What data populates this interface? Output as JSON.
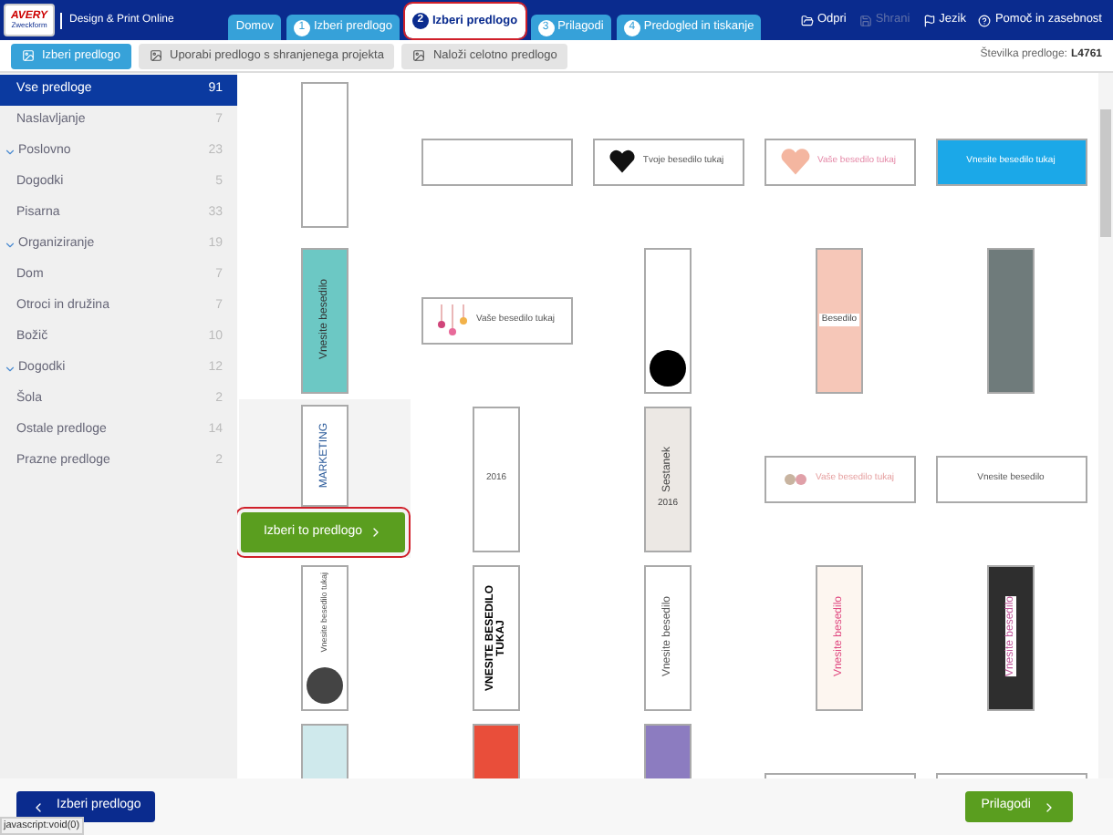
{
  "header": {
    "logo": [
      "AVERY",
      "Zweckform"
    ],
    "app_title": "Design & Print Online",
    "steps": [
      {
        "label": "Domov",
        "selected": false
      },
      {
        "number": "1",
        "label": "Izberi predlogo",
        "selected": false
      },
      {
        "number": "2",
        "label": "Izberi predlogo",
        "selected": true
      },
      {
        "number": "3",
        "label": "Prilagodi",
        "selected": false
      },
      {
        "number": "4",
        "label": "Predogled in tiskanje",
        "selected": false
      }
    ],
    "actions": [
      {
        "kind": "open",
        "label": "Odpri",
        "disabled": false
      },
      {
        "kind": "save",
        "label": "Shrani",
        "disabled": true
      },
      {
        "kind": "language",
        "label": "Jezik",
        "disabled": false
      },
      {
        "kind": "help",
        "label": "Pomoč in zasebnost",
        "disabled": false
      }
    ]
  },
  "toolbar": {
    "buttons": [
      {
        "label": "Izberi predlogo",
        "selected": true
      },
      {
        "label": "Uporabi predlogo s shranjenega projekta",
        "selected": false
      },
      {
        "label": "Naloži celotno predlogo",
        "selected": false
      }
    ],
    "template_number_label": "Številka predloge:",
    "template_number": "L4761"
  },
  "sidebar": {
    "items": [
      {
        "label": "Vse predloge",
        "count": "91",
        "selected": true
      },
      {
        "label": "Naslavljanje",
        "count": "7",
        "selected": false
      },
      {
        "label": "Poslovno",
        "count": "23",
        "selected": false,
        "expanded": true,
        "children": [
          {
            "label": "Dogodki",
            "count": "5",
            "selected": false
          },
          {
            "label": "Pisarna",
            "count": "33",
            "selected": false
          }
        ]
      },
      {
        "label": "Organiziranje",
        "count": "19",
        "selected": false,
        "expanded": true,
        "children": [
          {
            "label": "Dom",
            "count": "7",
            "selected": false
          },
          {
            "label": "Otroci in družina",
            "count": "7",
            "selected": false
          },
          {
            "label": "Božič",
            "count": "10",
            "selected": false
          }
        ]
      },
      {
        "label": "Dogodki",
        "count": "12",
        "selected": false,
        "expanded": true,
        "children": [
          {
            "label": "Šola",
            "count": "2",
            "selected": false
          },
          {
            "label": "Ostale predloge",
            "count": "14",
            "selected": false
          },
          {
            "label": "Prazne predloge",
            "count": "2",
            "selected": false
          }
        ]
      }
    ]
  },
  "templates": [
    {
      "kind": "tall"
    },
    {
      "kind": "wide"
    },
    {
      "kind": "wide",
      "texts": [
        "Tvoje besedilo tukaj"
      ]
    },
    {
      "kind": "wide",
      "texts": [
        "Vaše besedilo tukaj"
      ]
    },
    {
      "kind": "wide",
      "texts": [
        "Vnesite besedilo tukaj"
      ]
    },
    {
      "kind": "tall",
      "texts": [
        "Vnesite besedilo"
      ]
    },
    {
      "kind": "wide",
      "texts": [
        "Vaše besedilo tukaj"
      ]
    },
    {
      "kind": "tall"
    },
    {
      "kind": "tall",
      "texts": [
        "Besedilo"
      ]
    },
    {
      "kind": "tall"
    },
    {
      "kind": "tall",
      "texts": [
        "MARKETING"
      ],
      "hovered": true
    },
    {
      "kind": "tall",
      "texts": [
        "2016"
      ]
    },
    {
      "kind": "tall",
      "texts": [
        "Sestanek",
        "2016"
      ]
    },
    {
      "kind": "wide",
      "texts": [
        "Vaše besedilo tukaj"
      ]
    },
    {
      "kind": "wide",
      "texts": [
        "Vnesite besedilo"
      ]
    },
    {
      "kind": "tall",
      "texts": [
        "Vnesite besedilo tukaj"
      ]
    },
    {
      "kind": "tall",
      "texts": [
        "VNESITE BESEDILO TUKAJ"
      ]
    },
    {
      "kind": "tall",
      "texts": [
        "Vnesite besedilo"
      ]
    },
    {
      "kind": "tall",
      "texts": [
        "Vnesite besedilo"
      ]
    },
    {
      "kind": "tall",
      "texts": [
        "Vnesite besedilo"
      ]
    },
    {
      "kind": "tall"
    },
    {
      "kind": "tall"
    },
    {
      "kind": "tall"
    },
    {
      "kind": "wide"
    },
    {
      "kind": "wide"
    }
  ],
  "hover_button": "Izberi to predlogo",
  "footer": {
    "back": "Izberi predlogo",
    "next": "Prilagodi"
  },
  "status_bar": "javascript:void(0)"
}
